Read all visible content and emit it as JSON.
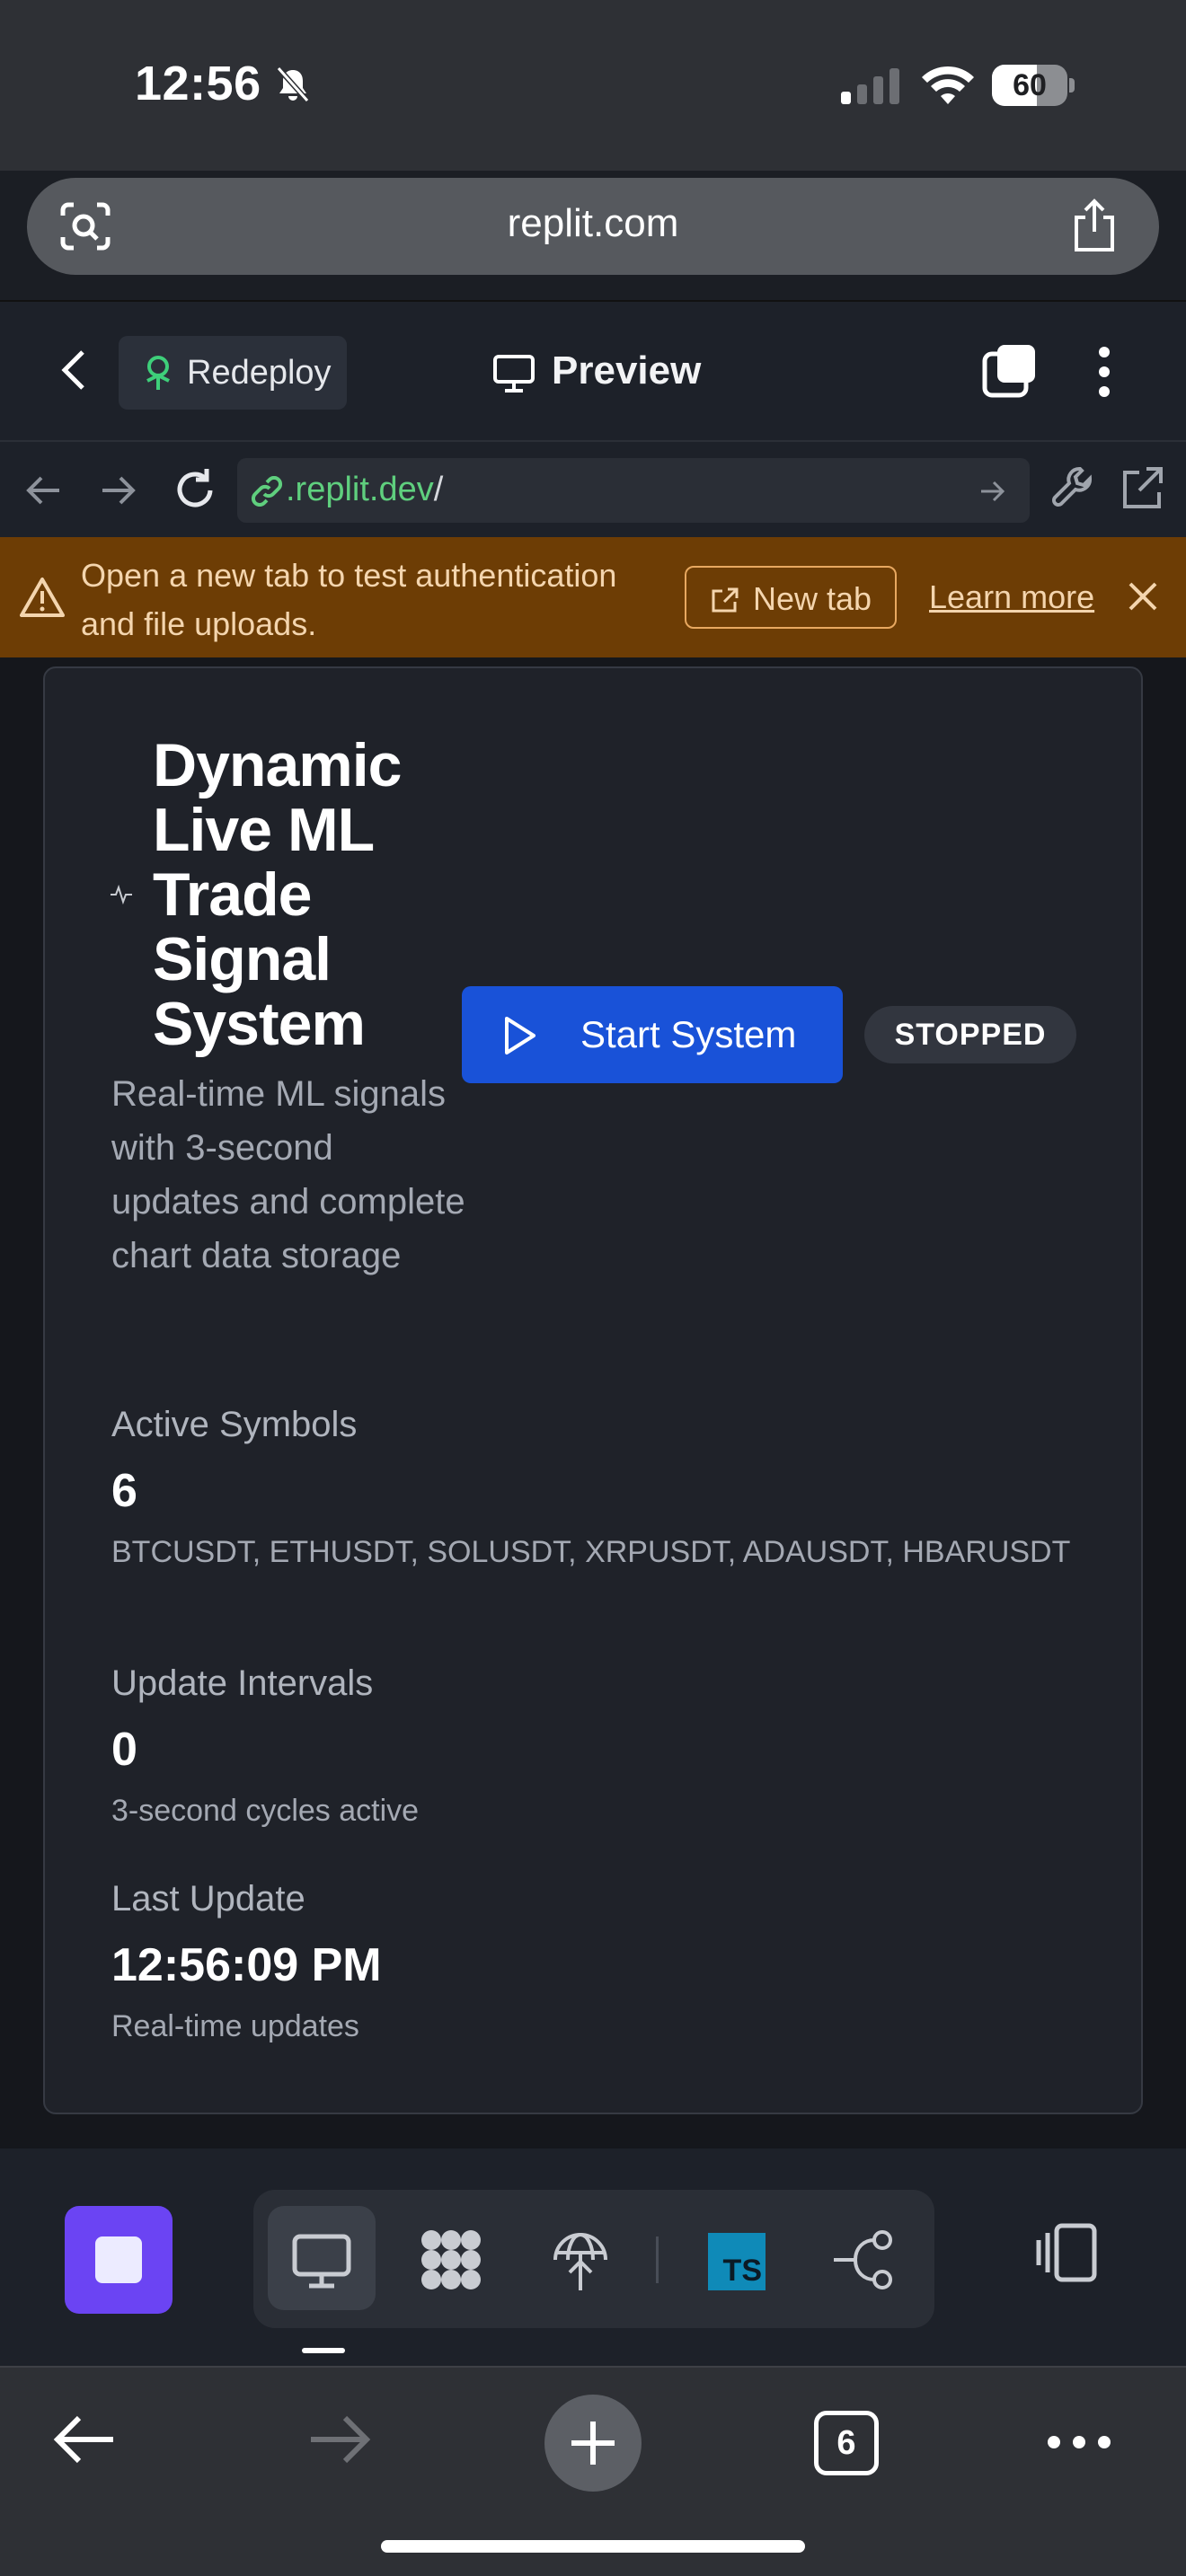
{
  "status_bar": {
    "time": "12:56",
    "battery": "60",
    "battery_level": 0.6
  },
  "browser": {
    "domain": "replit.com",
    "tab_count": "6"
  },
  "replit_header": {
    "redeploy_label": "Redeploy",
    "preview_label": "Preview"
  },
  "nav": {
    "address": ".replit.dev",
    "address_suffix": "/"
  },
  "banner": {
    "message": "Open a new tab to test authentication and file uploads.",
    "new_tab_label": "New tab",
    "learn_more_label": "Learn more"
  },
  "app": {
    "title": "Dynamic Live ML Trade Signal System",
    "subtitle": "Real-time ML signals with 3-second updates and complete chart data storage",
    "start_label": "Start System",
    "status": "STOPPED",
    "stats": [
      {
        "label": "Active Symbols",
        "value": "6",
        "note": "BTCUSDT, ETHUSDT, SOLUSDT, XRPUSDT, ADAUSDT, HBARUSDT"
      },
      {
        "label": "Update Intervals",
        "value": "0",
        "note": "3-second cycles active"
      },
      {
        "label": "Last Update",
        "value": "12:56:09 PM",
        "note": "Real-time updates"
      }
    ]
  },
  "dock": {
    "ts_label": "TS"
  },
  "colors": {
    "accent_blue": "#1952d8",
    "stop_purple": "#6b44f3",
    "banner_bg": "#6d3d05",
    "link_green": "#5fcf7e"
  }
}
